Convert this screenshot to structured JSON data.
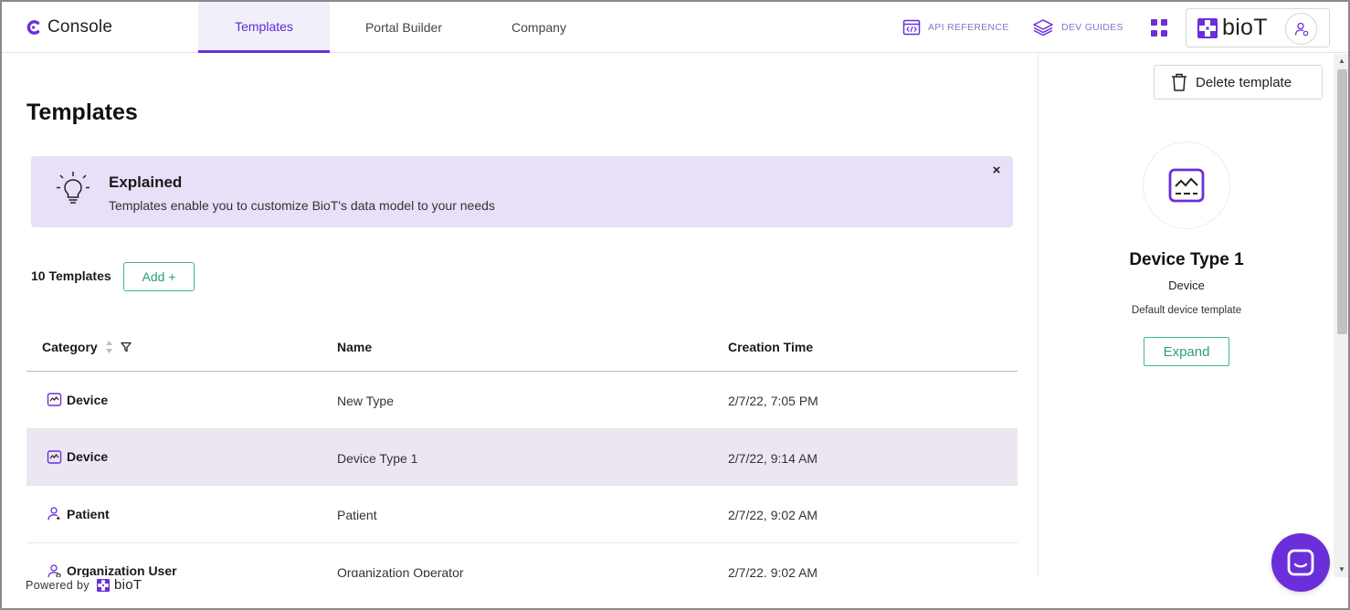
{
  "app": {
    "name": "Console"
  },
  "nav": {
    "tabs": [
      {
        "label": "Templates",
        "active": true
      },
      {
        "label": "Portal Builder",
        "active": false
      },
      {
        "label": "Company",
        "active": false
      }
    ],
    "links": {
      "api_reference": "API REFERENCE",
      "dev_guides": "DEV GUIDES"
    },
    "brand_logo": "bioT"
  },
  "page": {
    "title": "Templates",
    "banner": {
      "title": "Explained",
      "text": "Templates enable you to customize BioT's data model to your needs",
      "close": "×"
    },
    "count_label": "10 Templates",
    "add_label": "Add +"
  },
  "table": {
    "columns": {
      "category": "Category",
      "name": "Name",
      "creation_time": "Creation Time"
    },
    "rows": [
      {
        "category": "Device",
        "icon": "device-icon",
        "name": "New Type",
        "creation_time": "2/7/22, 7:05 PM",
        "selected": false
      },
      {
        "category": "Device",
        "icon": "device-icon",
        "name": "Device Type 1",
        "creation_time": "2/7/22, 9:14 AM",
        "selected": true
      },
      {
        "category": "Patient",
        "icon": "patient-icon",
        "name": "Patient",
        "creation_time": "2/7/22, 9:02 AM",
        "selected": false
      },
      {
        "category": "Organization User",
        "icon": "organization-user-icon",
        "name": "Organization Operator",
        "creation_time": "2/7/22, 9:02 AM",
        "selected": false
      }
    ]
  },
  "detail": {
    "delete_label": "Delete template",
    "title": "Device Type 1",
    "subtitle": "Device",
    "description": "Default device template",
    "expand_label": "Expand"
  },
  "footer": {
    "powered_by": "Powered by",
    "logo": "bioT"
  },
  "colors": {
    "accent": "#6b2fd9",
    "accent_tab_bg": "#f1effa",
    "banner_bg": "#e8dff9",
    "button_green": "#3fb68f",
    "selected_row": "#ebe6f2",
    "link_purple": "#8a73c9"
  }
}
